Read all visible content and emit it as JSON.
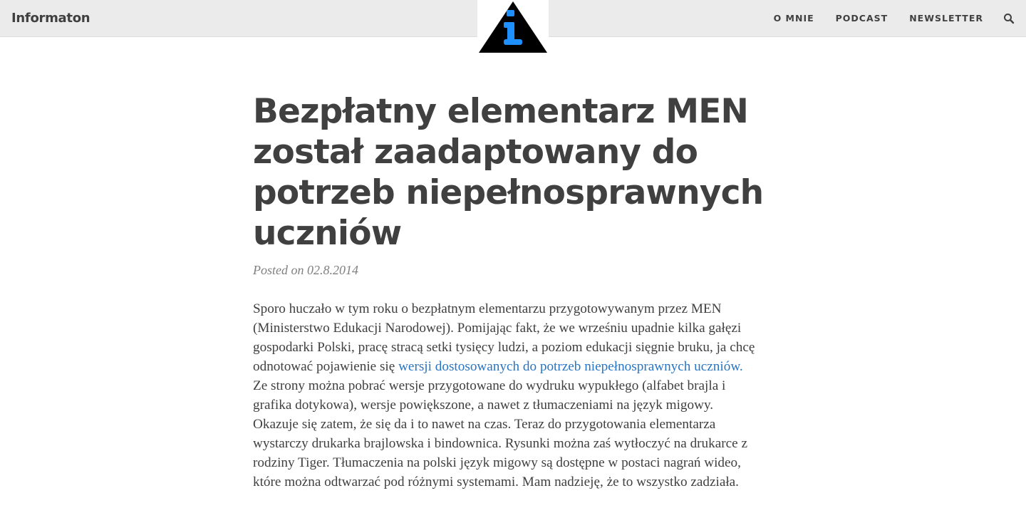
{
  "site": {
    "brand": "Informaton"
  },
  "nav": {
    "items": [
      {
        "label": "O mnie"
      },
      {
        "label": "Podcast"
      },
      {
        "label": "Newsletter"
      }
    ],
    "search_icon": "search-icon"
  },
  "logo": {
    "icon": "info-triangle-logo",
    "triangle_color": "#000000",
    "letter_color": "#1e90ff"
  },
  "post": {
    "title": "Bezpłatny elementarz MEN został zaadaptowany do potrzeb niepełnosprawnych uczniów",
    "posted_prefix": "Posted on",
    "date": "02.8.2014",
    "body_before_link": "Sporo huczało w tym roku o bezpłatnym elementarzu przygotowywanym przez MEN (Ministerstwo Edukacji Narodowej). Pomijając fakt, że we wrześniu upadnie kilka gałęzi gospodarki Polski, pracę stracą setki tysięcy ludzi, a poziom edukacji sięgnie bruku, ja chcę odnotować pojawienie się ",
    "link_text": "wersji dostosowanych do potrzeb niepełnosprawnych uczniów.",
    "body_after_link": " Ze strony można pobrać wersje przygotowane do wydruku wypukłego (alfabet brajla i grafika dotykowa), wersje powiększone, a nawet z tłumaczeniami na język migowy. Okazuje się zatem, że się da i to nawet na czas. Teraz do przygotowania elementarza wystarczy drukarka brajlowska i bindownica. Rysunki można zaś wytłoczyć na drukarce z rodziny Tiger. Tłumaczenia na polski język migowy są dostępne w postaci nagrań wideo, które można odtwarzać pod różnymi systemami. Mam nadzieję, że to wszystko zadziała."
  },
  "colors": {
    "navbar_bg": "#ebebeb",
    "text": "#404040",
    "meta": "#808080",
    "link": "#2775c4"
  }
}
